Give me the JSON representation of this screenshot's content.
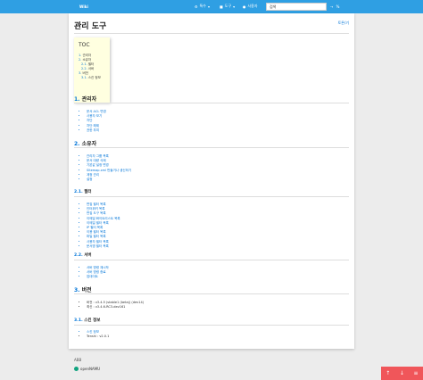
{
  "topbar": {
    "brand": "Wiki",
    "nav": [
      {
        "icon": "gear-icon",
        "glyph": "⚙",
        "label": "특수"
      },
      {
        "icon": "wrench-icon",
        "glyph": "■",
        "label": "도구"
      },
      {
        "icon": "user-icon",
        "glyph": "●",
        "label": "사용자"
      }
    ],
    "search_value": "검색",
    "search_btn_1": "→",
    "search_btn_2": "%"
  },
  "page": {
    "title": "관리 도구",
    "history_link": "토론/기"
  },
  "toc": {
    "title": "TOC",
    "items": [
      {
        "num": "1.",
        "label": "관리자",
        "sub": false
      },
      {
        "num": "2.",
        "label": "소유자",
        "sub": false
      },
      {
        "num": "2.1.",
        "label": "필터",
        "sub": true
      },
      {
        "num": "2.2.",
        "label": "서버",
        "sub": true
      },
      {
        "num": "3.",
        "label": "버전",
        "sub": false
      },
      {
        "num": "3.1.",
        "label": "스킨 정보",
        "sub": true
      }
    ]
  },
  "sections": {
    "s1": {
      "num": "1.",
      "title": "관리자",
      "items": [
        "문서 ACL 변경",
        "사용자 보기",
        "차단",
        "차단 해제",
        "권한 부여"
      ]
    },
    "s2": {
      "num": "2.",
      "title": "소유자",
      "items": [
        "관리자 그룹 목록",
        "문서 대량 삭제",
        "기본값 설정 변경",
        "Sitemap.xml 만들거나 생신하기",
        "계정 관리",
        "설정"
      ]
    },
    "s21": {
      "num": "2.1.",
      "title": "필터",
      "items": [
        "편집 필터 목록",
        "인터위키 목록",
        "편집 도구 목록",
        "이메일 화이트리스트 목록",
        "이메일 필터 목록",
        "IP 필터 목록",
        "이용 필터 목록",
        "파일 필터 목록",
        "사용자 필터 목록",
        "문서명 필터 목록"
      ]
    },
    "s22": {
      "num": "2.2.",
      "title": "서버",
      "items": [
        "서버 명령 재시작",
        "서버 명령 종료",
        "업데이트"
      ]
    },
    "s3": {
      "num": "3.",
      "title": "버전",
      "items": [
        "버전 : v3.4.5 (stable1 (beta)) (dev14)",
        "최신 : v3.4.6-RC3-dev161"
      ]
    },
    "s31": {
      "num": "3.1.",
      "title": "스킨 정보",
      "items": [
        "스킨 정보",
        "Tenshi : v2.0.1"
      ]
    }
  },
  "footer": {
    "label": "ABB",
    "logo_text": "openNAMU"
  },
  "scroll": {
    "up": "↑",
    "down": "↓",
    "menu": "≡"
  }
}
